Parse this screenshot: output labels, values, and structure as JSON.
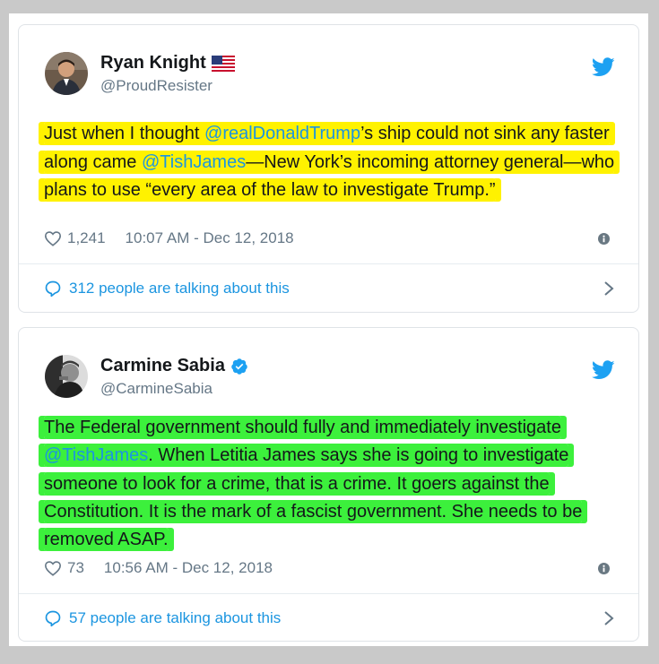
{
  "tweets": [
    {
      "name": "Ryan Knight",
      "handle": "@ProudResister",
      "verified": false,
      "flag": "us-flag-icon",
      "body": {
        "t1": "Just when I thought ",
        "m1": "@realDonaldTrump",
        "t2": "’s ship could not sink any faster along came ",
        "m2": "@TishJames",
        "t3": "—New York’s incoming attorney general—who plans to use “every area of the law to investigate Trump.”"
      },
      "likes": "1,241",
      "timestamp": "10:07 AM - Dec 12, 2018",
      "talking": "312 people are talking about this",
      "highlight_color": "#fff200"
    },
    {
      "name": "Carmine Sabia",
      "handle": "@CarmineSabia",
      "verified": true,
      "body": {
        "t1": "The Federal government should fully and immediately investigate ",
        "m1": "@TishJames",
        "t2": ". When Letitia James says she is going to investigate someone to look for a crime, that is a crime. It goers against the Constitution. It is the mark of a fascist government. She needs to be removed ASAP."
      },
      "likes": "73",
      "timestamp": "10:56 AM - Dec 12, 2018",
      "talking": "57 people are talking about this",
      "highlight_color": "#3cf03c"
    }
  ],
  "colors": {
    "twitter_blue": "#1b95e0",
    "secondary_text": "#657786",
    "background": "#c9c9c9"
  }
}
